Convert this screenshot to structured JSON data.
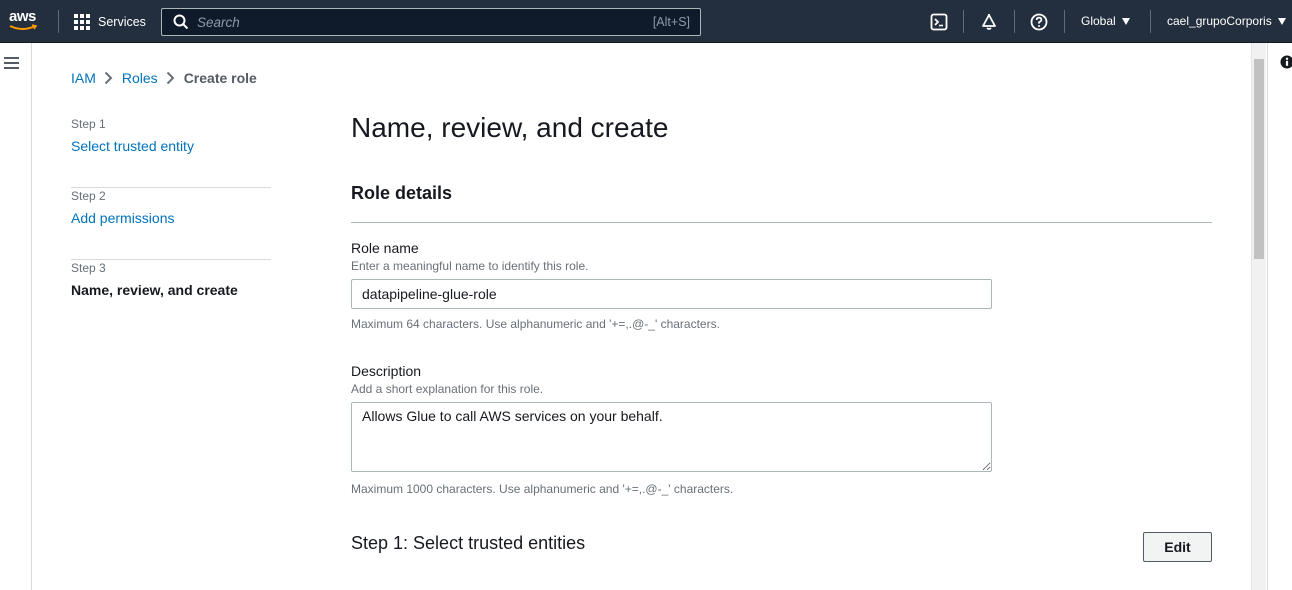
{
  "topnav": {
    "logo_text": "aws",
    "services_label": "Services",
    "search_placeholder": "Search",
    "search_shortcut": "[Alt+S]",
    "region_label": "Global",
    "account_label": "cael_grupoCorporis"
  },
  "breadcrumb": {
    "items": [
      "IAM",
      "Roles"
    ],
    "current": "Create role"
  },
  "steps": [
    {
      "number": "Step 1",
      "title": "Select trusted entity"
    },
    {
      "number": "Step 2",
      "title": "Add permissions"
    },
    {
      "number": "Step 3",
      "title": "Name, review, and create"
    }
  ],
  "main": {
    "page_title": "Name, review, and create",
    "section_title": "Role details",
    "role_name": {
      "label": "Role name",
      "description": "Enter a meaningful name to identify this role.",
      "value": "datapipeline-glue-role",
      "constraint": "Maximum 64 characters. Use alphanumeric and '+=,.@-_' characters."
    },
    "description": {
      "label": "Description",
      "description": "Add a short explanation for this role.",
      "value": "Allows Glue to call AWS services on your behalf.",
      "constraint": "Maximum 1000 characters. Use alphanumeric and '+=,.@-_' characters."
    },
    "step1_section": {
      "title": "Step 1: Select trusted entities",
      "edit_label": "Edit"
    }
  },
  "icons": {
    "services": "grid-icon",
    "search": "search-icon",
    "cloudshell": "terminal-icon",
    "notifications": "bell-icon",
    "help": "help-icon",
    "menu": "hamburger-icon",
    "info": "info-icon"
  },
  "colors": {
    "nav_bg": "#232f3e",
    "link": "#0073bb",
    "aws_orange": "#ff9900"
  }
}
